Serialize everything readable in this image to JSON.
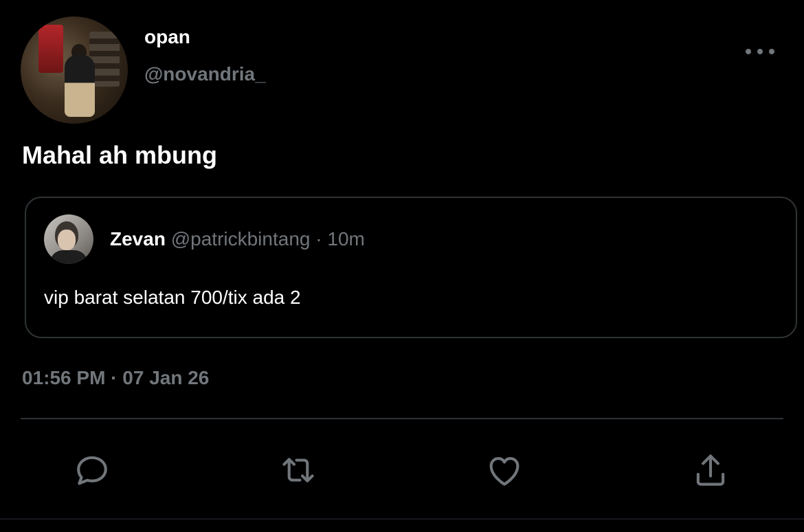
{
  "author": {
    "name": "opan",
    "handle": "@novandria_"
  },
  "tweet": {
    "text": "Mahal ah mbung",
    "timestamp": "01:56 PM · 07 Jan 26"
  },
  "quoted": {
    "name": "Zevan",
    "handle": "@patrickbintang",
    "separator": "·",
    "time": "10m",
    "text": "vip barat selatan 700/tix ada 2"
  },
  "actions": [
    {
      "icon": "reply-icon"
    },
    {
      "icon": "retweet-icon"
    },
    {
      "icon": "like-icon"
    },
    {
      "icon": "share-icon"
    }
  ],
  "colors": {
    "background": "#000000",
    "primary_text": "#ffffff",
    "secondary_text": "#71767b",
    "border": "#2f3336"
  }
}
